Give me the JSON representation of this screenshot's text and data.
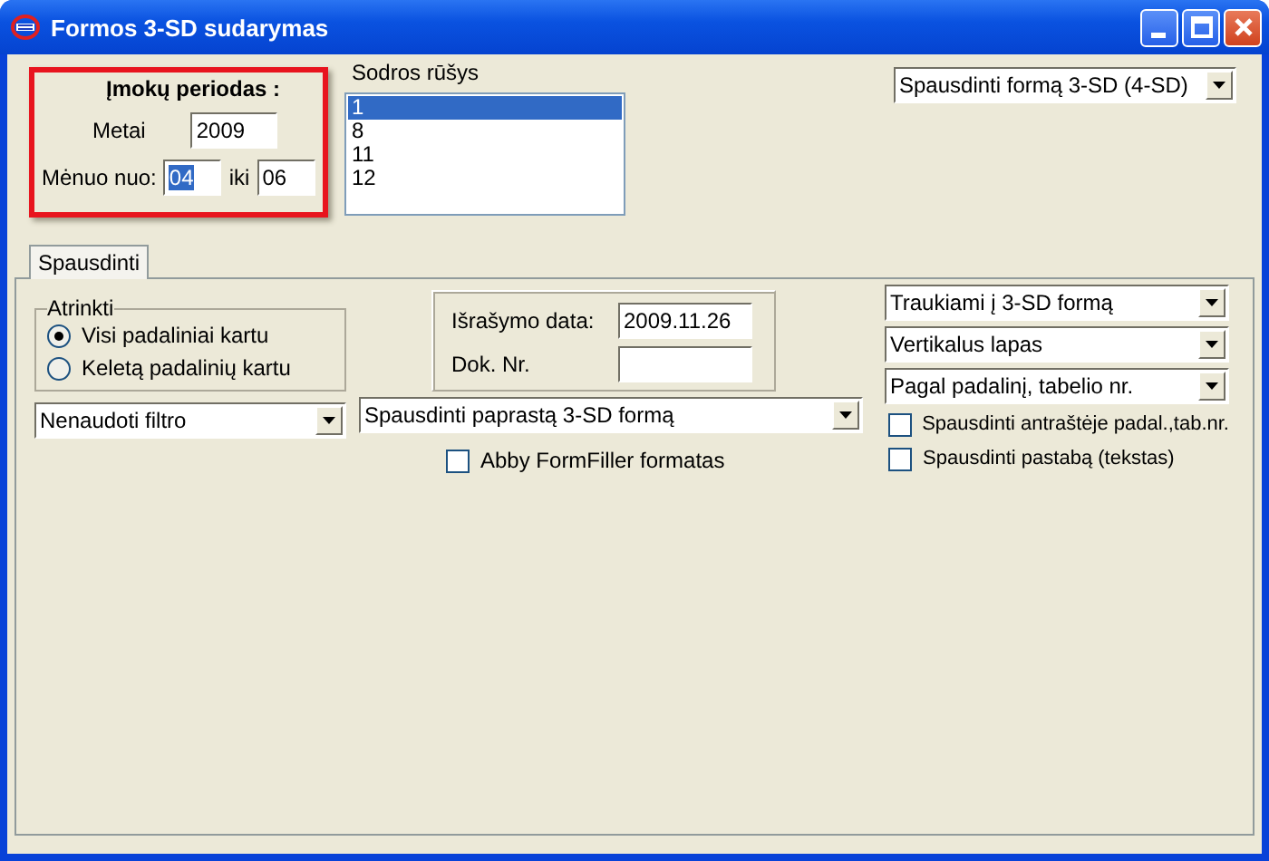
{
  "window": {
    "title": "Formos 3-SD sudarymas"
  },
  "period": {
    "highlighted": true,
    "title": "Įmokų periodas :",
    "year_label": "Metai",
    "year": "2009",
    "month_label": "Mėnuo nuo:",
    "month_from": "04",
    "month_from_selected": true,
    "to_label": "iki",
    "month_to": "06"
  },
  "fund_types": {
    "label": "Sodros rūšys",
    "items": [
      {
        "text": "1",
        "selected": true
      },
      {
        "text": "8",
        "selected": false
      },
      {
        "text": "11",
        "selected": false
      },
      {
        "text": "12",
        "selected": false
      }
    ]
  },
  "print_form_select": {
    "value": "Spausdinti formą 3-SD  (4-SD)"
  },
  "tabs": [
    {
      "label": "Spausdinti",
      "selected": true
    }
  ],
  "filter_group": {
    "title": "Atrinkti",
    "options": [
      {
        "label": "Visi padaliniai kartu",
        "selected": true
      },
      {
        "label": "Keletą padalinių kartu",
        "selected": false
      }
    ]
  },
  "filter_select": {
    "value": "Nenaudoti filtro"
  },
  "issue": {
    "date_label": "Išrašymo data:",
    "date": "2009.11.26",
    "doc_label": "Dok. Nr."
  },
  "print_type_select": {
    "value": "Spausdinti paprastą 3-SD formą"
  },
  "abby": {
    "label": "Abby FormFiller formatas",
    "checked": false
  },
  "right_selects": [
    {
      "value": "Traukiami į 3-SD formą"
    },
    {
      "value": "Vertikalus lapas"
    },
    {
      "value": "Pagal padalinį, tabelio nr."
    }
  ],
  "right_checks": [
    {
      "label": "Spausdinti antraštėje padal.,tab.nr.",
      "checked": false
    },
    {
      "label": "Spausdinti pastabą (tekstas)",
      "checked": false
    }
  ]
}
